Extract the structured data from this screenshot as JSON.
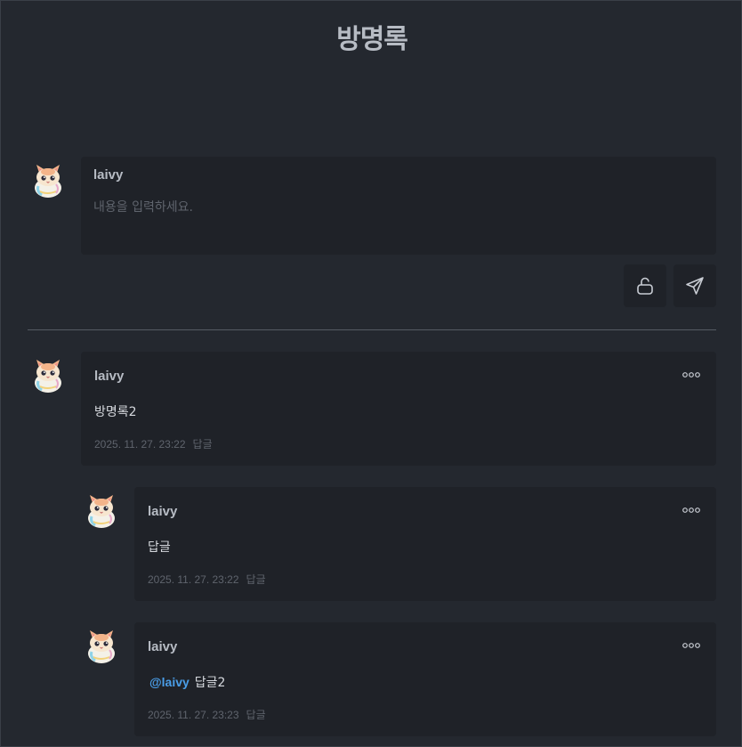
{
  "page": {
    "title": "방명록"
  },
  "compose": {
    "username": "laivy",
    "placeholder": "내용을 입력하세요.",
    "lock_icon": "unlock-icon",
    "send_icon": "send-icon"
  },
  "entries": [
    {
      "username": "laivy",
      "content": "방명록2",
      "mention": "",
      "timestamp": "2025. 11. 27. 23:22",
      "reply_label": "답글"
    },
    {
      "username": "laivy",
      "content": "답글",
      "mention": "",
      "timestamp": "2025. 11. 27. 23:22",
      "reply_label": "답글"
    },
    {
      "username": "laivy",
      "content": "답글2",
      "mention": "@laivy",
      "timestamp": "2025. 11. 27. 23:23",
      "reply_label": "답글"
    }
  ]
}
